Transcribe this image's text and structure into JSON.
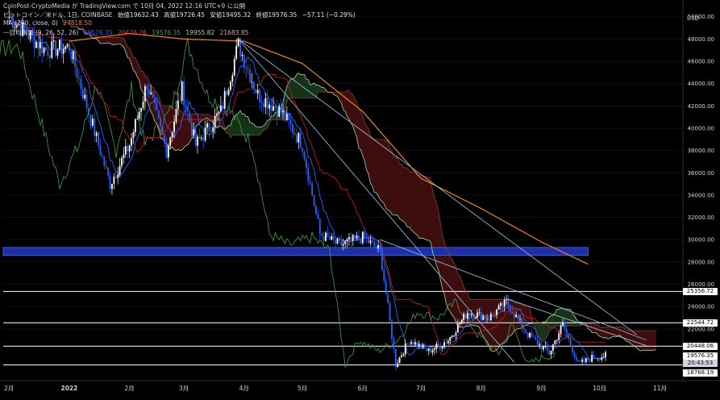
{
  "attribution": "CoinPost-CryptoMedia が TradingView.com で 10月 04, 2022 12:16 UTC+9 に公開",
  "header": {
    "symbol": "ビットコイン／米ドル, 1日, COINBASE",
    "open": "始値19632.43",
    "high": "高値19726.45",
    "low": "安値19495.32",
    "close": "終値19576.35",
    "change": "−57.11 (−0.29%)",
    "ma_label": "MA (200, close, 0)",
    "ma_value": "27818.50",
    "ichimoku_label": "一目均衡表 (9, 26, 52, 26)",
    "ichi_v1": "19576.35",
    "ichi_v2": "20476.26",
    "ichi_v3": "19576.35",
    "ichi_v4": "19955.82",
    "ichi_v5": "21683.85"
  },
  "colors": {
    "background": "#000000",
    "candle_up": "#ffffff",
    "candle_down": "#2962ff",
    "ma": "#e8852b",
    "tenkan": "#2962ff",
    "kijun": "#b71c1c",
    "chikou": "#43a047",
    "span_a": "#a5d6a7",
    "span_b": "#8b3a3a",
    "cloud_bear": "#4a1010",
    "cloud_bull": "#1b3d1b",
    "zone": "#1f2fa0",
    "zone_edge": "#3b5bd6",
    "trendline": "#9ab4cf",
    "hline": "#ffffff"
  },
  "chart_data": {
    "type": "candlestick",
    "currency": "USD",
    "x_labels": [
      "2月",
      "2022",
      "2月",
      "3月",
      "4月",
      "5月",
      "6月",
      "7月",
      "8月",
      "9月",
      "10月",
      "11月"
    ],
    "y_ticks": [
      "50000.00",
      "48000.00",
      "46000.00",
      "44000.00",
      "42000.00",
      "40000.00",
      "38000.00",
      "36000.00",
      "34000.00",
      "32000.00",
      "30000.00",
      "28000.00",
      "26000.00",
      "24000.00",
      "22000.00"
    ],
    "ylim": [
      17500,
      51500
    ],
    "price_labels": [
      {
        "value": 25356.72,
        "text": "25356.72",
        "style": "white"
      },
      {
        "value": 22544.72,
        "text": "22544.72",
        "style": "white"
      },
      {
        "value": 20448.06,
        "text": "20448.06",
        "style": "white"
      },
      {
        "value": 19576.35,
        "text": "19576.35",
        "style": "white"
      },
      {
        "value": 18768.19,
        "text": "18768.19",
        "style": "white"
      }
    ],
    "countdown": "20:43:53",
    "horizontal_levels": [
      25356.72,
      22544.72,
      20448.06,
      18768.19
    ],
    "support_zone": [
      28600,
      29300
    ],
    "ma200": [
      {
        "d": "2022-01-01",
        "v": 47800
      },
      {
        "d": "2022-02-01",
        "v": 48500
      },
      {
        "d": "2022-03-01",
        "v": 48000
      },
      {
        "d": "2022-04-01",
        "v": 47800
      },
      {
        "d": "2022-05-01",
        "v": 45800
      },
      {
        "d": "2022-06-01",
        "v": 41500
      },
      {
        "d": "2022-07-01",
        "v": 35500
      },
      {
        "d": "2022-08-01",
        "v": 32800
      },
      {
        "d": "2022-09-01",
        "v": 29800
      },
      {
        "d": "2022-09-25",
        "v": 27800
      }
    ],
    "price_path": [
      {
        "d": "2021-12-01",
        "v": 50000
      },
      {
        "d": "2021-12-10",
        "v": 48500
      },
      {
        "d": "2021-12-20",
        "v": 47000
      },
      {
        "d": "2022-01-01",
        "v": 47300
      },
      {
        "d": "2022-01-10",
        "v": 42000
      },
      {
        "d": "2022-01-22",
        "v": 35000
      },
      {
        "d": "2022-02-01",
        "v": 38500
      },
      {
        "d": "2022-02-10",
        "v": 44000
      },
      {
        "d": "2022-02-20",
        "v": 38000
      },
      {
        "d": "2022-02-28",
        "v": 43500
      },
      {
        "d": "2022-03-07",
        "v": 38500
      },
      {
        "d": "2022-03-20",
        "v": 41500
      },
      {
        "d": "2022-03-29",
        "v": 47500
      },
      {
        "d": "2022-04-08",
        "v": 43000
      },
      {
        "d": "2022-04-20",
        "v": 41500
      },
      {
        "d": "2022-05-01",
        "v": 38500
      },
      {
        "d": "2022-05-10",
        "v": 30500
      },
      {
        "d": "2022-05-20",
        "v": 29500
      },
      {
        "d": "2022-06-01",
        "v": 30200
      },
      {
        "d": "2022-06-10",
        "v": 29000
      },
      {
        "d": "2022-06-18",
        "v": 18800
      },
      {
        "d": "2022-06-25",
        "v": 21000
      },
      {
        "d": "2022-07-05",
        "v": 20000
      },
      {
        "d": "2022-07-15",
        "v": 21000
      },
      {
        "d": "2022-07-25",
        "v": 23500
      },
      {
        "d": "2022-08-05",
        "v": 23000
      },
      {
        "d": "2022-08-14",
        "v": 24400
      },
      {
        "d": "2022-08-25",
        "v": 21500
      },
      {
        "d": "2022-09-05",
        "v": 19800
      },
      {
        "d": "2022-09-12",
        "v": 22400
      },
      {
        "d": "2022-09-20",
        "v": 18800
      },
      {
        "d": "2022-09-28",
        "v": 19500
      },
      {
        "d": "2022-10-04",
        "v": 19576
      }
    ]
  }
}
